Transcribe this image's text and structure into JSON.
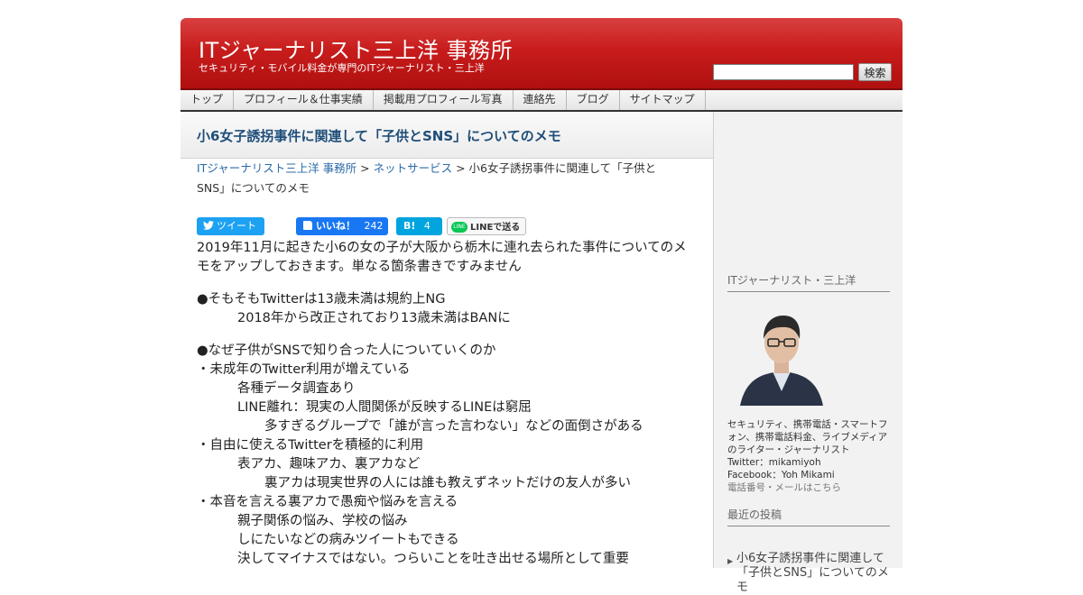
{
  "header": {
    "site_title": "ITジャーナリスト三上洋 事務所",
    "site_description": "セキュリティ・モバイル料金が専門のITジャーナリスト・三上洋",
    "search_placeholder": "",
    "search_button": "検索",
    "brand_color": "#c81c1c"
  },
  "nav": {
    "items": [
      "トップ",
      "プロフィール＆仕事実績",
      "掲載用プロフィール写真",
      "連絡先",
      "ブログ",
      "サイトマップ"
    ]
  },
  "post": {
    "title": "小6女子誘拐事件に関連して「子供とSNS」についてのメモ",
    "breadcrumb": {
      "home": "ITジャーナリスト三上洋 事務所",
      "sep1": " > ",
      "category": "ネットサービス",
      "sep2": " > ",
      "current": "小6女子誘拐事件に関連して「子供とSNS」についてのメモ"
    },
    "share": {
      "tweet": "ツイート",
      "like": "いいね！",
      "like_count": "242",
      "hatena": "B!",
      "hatena_count": "4",
      "line_icon": "LINE",
      "line": "LINEで送る"
    },
    "intro": "2019年11月に起きた小6の女の子が大阪から栃木に連れ去られた事件についてのメモをアップしておきます。単なる箇条書きですみません",
    "lines": [
      {
        "indent": 0,
        "text": "●そもそもTwitterは13歳未満は規約上NG"
      },
      {
        "indent": 1,
        "text": "2018年から改正されており13歳未満はBANに"
      },
      {
        "indent": -1,
        "text": ""
      },
      {
        "indent": 0,
        "text": "●なぜ子供がSNSで知り合った人についていくのか"
      },
      {
        "indent": 0,
        "text": "・未成年のTwitter利用が増えている"
      },
      {
        "indent": 1,
        "text": "各種データ調査あり"
      },
      {
        "indent": 1,
        "text": "LINE離れ：現実の人間関係が反映するLINEは窮屈"
      },
      {
        "indent": 2,
        "text": "多すぎるグループで「誰が言った言わない」などの面倒さがある"
      },
      {
        "indent": 0,
        "text": "・自由に使えるTwitterを積極的に利用"
      },
      {
        "indent": 1,
        "text": "表アカ、趣味アカ、裏アカなど"
      },
      {
        "indent": 2,
        "text": "裏アカは現実世界の人には誰も教えずネットだけの友人が多い"
      },
      {
        "indent": 0,
        "text": "・本音を言える裏アカで愚痴や悩みを言える"
      },
      {
        "indent": 1,
        "text": "親子関係の悩み、学校の悩み"
      },
      {
        "indent": 1,
        "text": "しにたいなどの病みツイートもできる"
      },
      {
        "indent": 1,
        "text": "決してマイナスではない。つらいことを吐き出せる場所として重要"
      }
    ]
  },
  "sidebar": {
    "profile_heading": "ITジャーナリスト・三上洋",
    "profile_description": "セキュリティ、携帯電話・スマートフォン、携帯電話料金、ライブメディアのライター・ジャーナリスト",
    "twitter": "Twitter：mikamiyoh",
    "facebook": "Facebook：Yoh Mikami",
    "contact": "電話番号・メールはこちら",
    "recent_heading": "最近の投稿",
    "recent_posts": [
      "小6女子誘拐事件に関連して「子供とSNS」についてのメモ"
    ]
  }
}
